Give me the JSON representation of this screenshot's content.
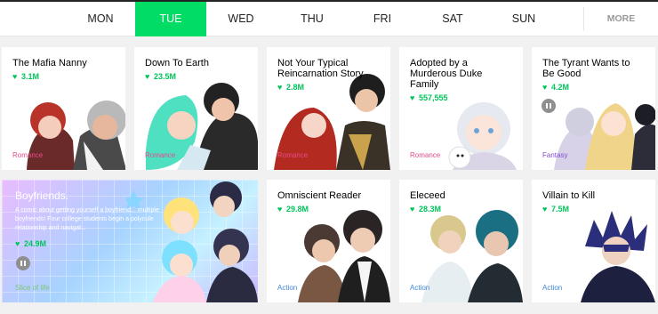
{
  "tabs": [
    {
      "label": "MON",
      "active": false
    },
    {
      "label": "TUE",
      "active": true
    },
    {
      "label": "WED",
      "active": false
    },
    {
      "label": "THU",
      "active": false
    },
    {
      "label": "FRI",
      "active": false
    },
    {
      "label": "SAT",
      "active": false
    },
    {
      "label": "SUN",
      "active": false
    }
  ],
  "more_label": "MORE",
  "accent_color": "#00dc64",
  "cards": [
    {
      "title": "The Mafia Nanny",
      "likes": "3.1M",
      "genre": "Romance",
      "genre_color": "#e64c8a"
    },
    {
      "title": "Down To Earth",
      "likes": "23.5M",
      "genre": "Romance",
      "genre_color": "#e64c8a"
    },
    {
      "title": "Not Your Typical Reincarnation Story",
      "likes": "2.8M",
      "genre": "Romance",
      "genre_color": "#e64c8a"
    },
    {
      "title": "Adopted by a Murderous Duke Family",
      "likes": "557,555",
      "genre": "Romance",
      "genre_color": "#e64c8a"
    },
    {
      "title": "The Tyrant Wants to Be Good",
      "likes": "4.2M",
      "genre": "Fantasy",
      "genre_color": "#8a4bd6"
    },
    {
      "title": "Boyfriends.",
      "description": "A comic about getting yourself a boyfriend... multiple boyfriends! Four college students begin a polycule relationship and navigat...",
      "likes": "24.9M",
      "genre": "Slice of life",
      "genre_color": "#7cc576"
    },
    {
      "title": "Omniscient Reader",
      "likes": "29.8M",
      "genre": "Action",
      "genre_color": "#3f87d6"
    },
    {
      "title": "Eleceed",
      "likes": "28.3M",
      "genre": "Action",
      "genre_color": "#3f87d6"
    },
    {
      "title": "Villain to Kill",
      "likes": "7.5M",
      "genre": "Action",
      "genre_color": "#3f87d6"
    }
  ]
}
